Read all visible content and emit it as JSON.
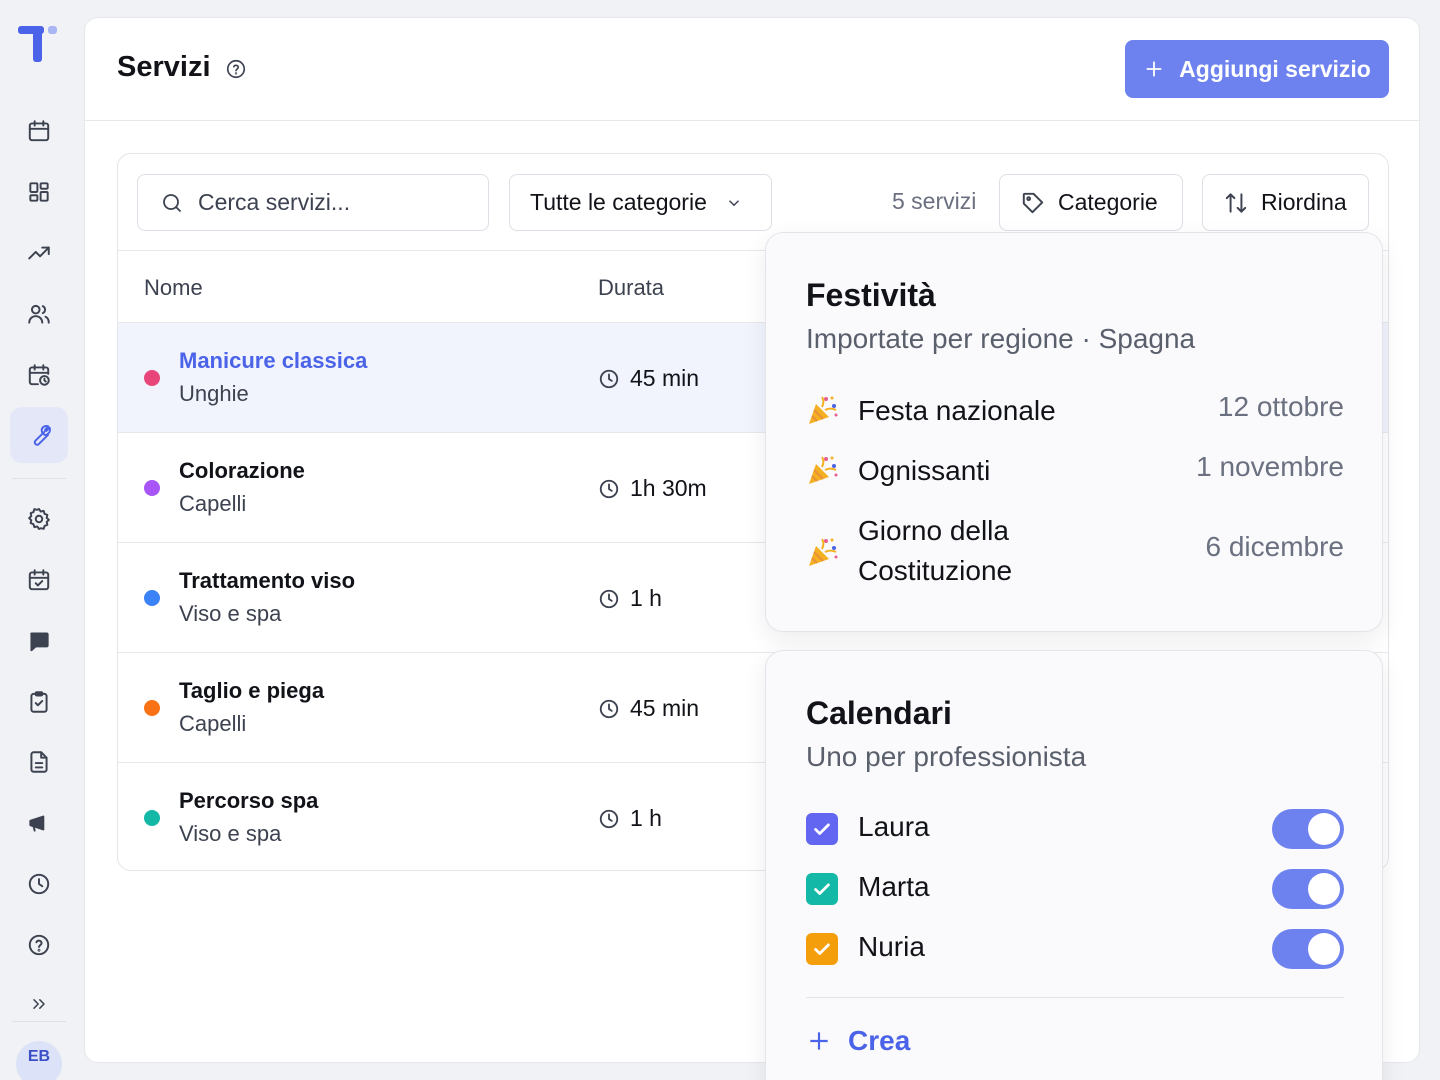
{
  "sidebar": {
    "avatar_initials": "EB",
    "items": [
      {
        "icon": "calendar-icon"
      },
      {
        "icon": "dashboard-icon"
      },
      {
        "icon": "trending-up-icon"
      },
      {
        "icon": "users-icon"
      },
      {
        "icon": "calendar-clock-icon"
      },
      {
        "icon": "wrench-icon",
        "active": true
      },
      {
        "icon": "gear-icon"
      },
      {
        "icon": "calendar-check-icon"
      },
      {
        "icon": "chat-icon"
      },
      {
        "icon": "clipboard-check-icon"
      },
      {
        "icon": "document-icon"
      },
      {
        "icon": "megaphone-icon"
      },
      {
        "icon": "clock-icon"
      },
      {
        "icon": "help-icon"
      },
      {
        "icon": "expand-icon"
      }
    ]
  },
  "header": {
    "title": "Servizi",
    "add_button": "Aggiungi servizio"
  },
  "toolbar": {
    "search_placeholder": "Cerca servizi...",
    "category_select": "Tutte le categorie",
    "count": "5 servizi",
    "categories_button": "Categorie",
    "reorder_button": "Riordina"
  },
  "table": {
    "columns": [
      "Nome",
      "Durata"
    ],
    "rows": [
      {
        "name": "Manicure classica",
        "category": "Unghie",
        "duration": "45 min",
        "color": "#e8457a",
        "selected": true
      },
      {
        "name": "Colorazione",
        "category": "Capelli",
        "duration": "1h 30m",
        "color": "#a855f7"
      },
      {
        "name": "Trattamento viso",
        "category": "Viso e spa",
        "duration": "1 h",
        "color": "#3b82f6"
      },
      {
        "name": "Taglio e piega",
        "category": "Capelli",
        "duration": "45 min",
        "color": "#f97316"
      },
      {
        "name": "Percorso spa",
        "category": "Viso e spa",
        "duration": "1 h",
        "color": "#14b8a6"
      }
    ]
  },
  "holidays": {
    "title": "Festività",
    "subtitle": "Importate per regione · Spagna",
    "items": [
      {
        "name": "Festa nazionale",
        "date": "12 ottobre"
      },
      {
        "name": "Ognissanti",
        "date": "1 novembre"
      },
      {
        "name": "Giorno della Costituzione",
        "date": "6 dicembre"
      }
    ]
  },
  "calendars": {
    "title": "Calendari",
    "subtitle": "Uno per professionista",
    "items": [
      {
        "name": "Laura",
        "color": "#6366f1",
        "enabled": true
      },
      {
        "name": "Marta",
        "color": "#14b8a6",
        "enabled": true
      },
      {
        "name": "Nuria",
        "color": "#f59e0b",
        "enabled": true
      }
    ],
    "create_label": "Crea"
  }
}
